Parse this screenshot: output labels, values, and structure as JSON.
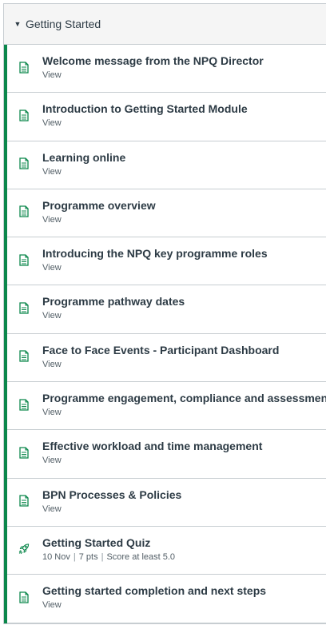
{
  "module": {
    "title": "Getting Started",
    "caret_icon": "caret-down-icon"
  },
  "items": [
    {
      "title": "Welcome message from the NPQ Director",
      "meta": "View",
      "icon": "page-icon"
    },
    {
      "title": "Introduction to Getting Started Module",
      "meta": "View",
      "icon": "page-icon"
    },
    {
      "title": "Learning online",
      "meta": "View",
      "icon": "page-icon"
    },
    {
      "title": "Programme overview",
      "meta": "View",
      "icon": "page-icon"
    },
    {
      "title": "Introducing the NPQ key programme roles",
      "meta": "View",
      "icon": "page-icon"
    },
    {
      "title": "Programme pathway dates",
      "meta": "View",
      "icon": "page-icon"
    },
    {
      "title": "Face to Face Events - Participant Dashboard",
      "meta": "View",
      "icon": "page-icon"
    },
    {
      "title": "Programme engagement, compliance and assessment",
      "meta": "View",
      "icon": "page-icon"
    },
    {
      "title": "Effective workload and time management",
      "meta": "View",
      "icon": "page-icon"
    },
    {
      "title": "BPN Processes & Policies",
      "meta": "View",
      "icon": "page-icon"
    },
    {
      "title": "Getting Started Quiz",
      "icon": "quiz-rocket-icon",
      "quiz_meta": {
        "date": "10 Nov",
        "points": "7 pts",
        "requirement": "Score at least 5.0"
      }
    },
    {
      "title": "Getting started completion and next steps",
      "meta": "View",
      "icon": "page-icon"
    }
  ],
  "colors": {
    "accent_bar": "#0b874b",
    "icon_green": "#0b874b",
    "header_bg": "#f5f5f5",
    "border": "#c7cdd1"
  }
}
